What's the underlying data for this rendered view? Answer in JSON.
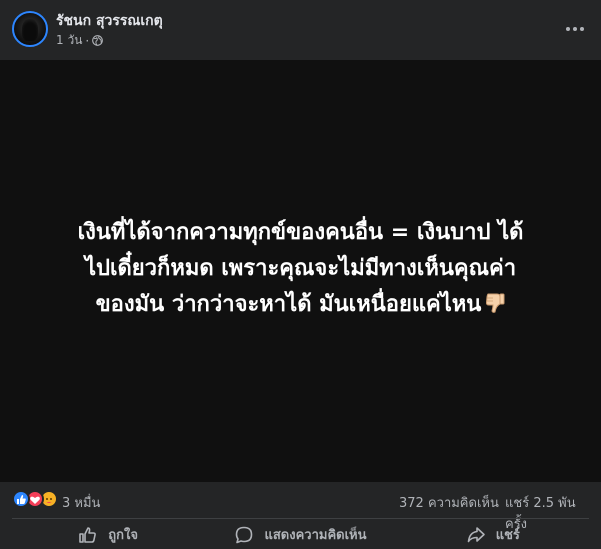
{
  "header": {
    "author_name": "รัชนก สุวรรณเกตุ",
    "time": "1 วัน",
    "separator": "·",
    "privacy_icon": "globe-icon",
    "more_icon": "more-horizontal-icon"
  },
  "media": {
    "background_color": "#101010",
    "text_lines": [
      "เงินที่ได้จากความทุกข์ของคนอื่น = เงินบาป ได้",
      "ไปเดี๋ยวก็หมด เพราะคุณจะไม่มีทางเห็นคุณค่า",
      "ของมัน ว่ากว่าจะหาได้ มันเหนื่อยแค่ไหน"
    ],
    "emoji": "thumbs-down-emoji"
  },
  "stats": {
    "reactions": [
      "like",
      "love",
      "care"
    ],
    "reaction_count": "3 หมื่น",
    "comment_count": "372 ความคิดเห็น",
    "share_count": "แชร์ 2.5 พัน ครั้ง"
  },
  "actions": {
    "like_label": "ถูกใจ",
    "comment_label": "แสดงความคิดเห็น",
    "share_label": "แชร์"
  },
  "colors": {
    "background": "#242526",
    "text_primary": "#e4e6eb",
    "text_secondary": "#b0b3b8",
    "like_blue": "#2d86ff",
    "love_red": "#f33e58",
    "care_yellow": "#f7b125"
  }
}
